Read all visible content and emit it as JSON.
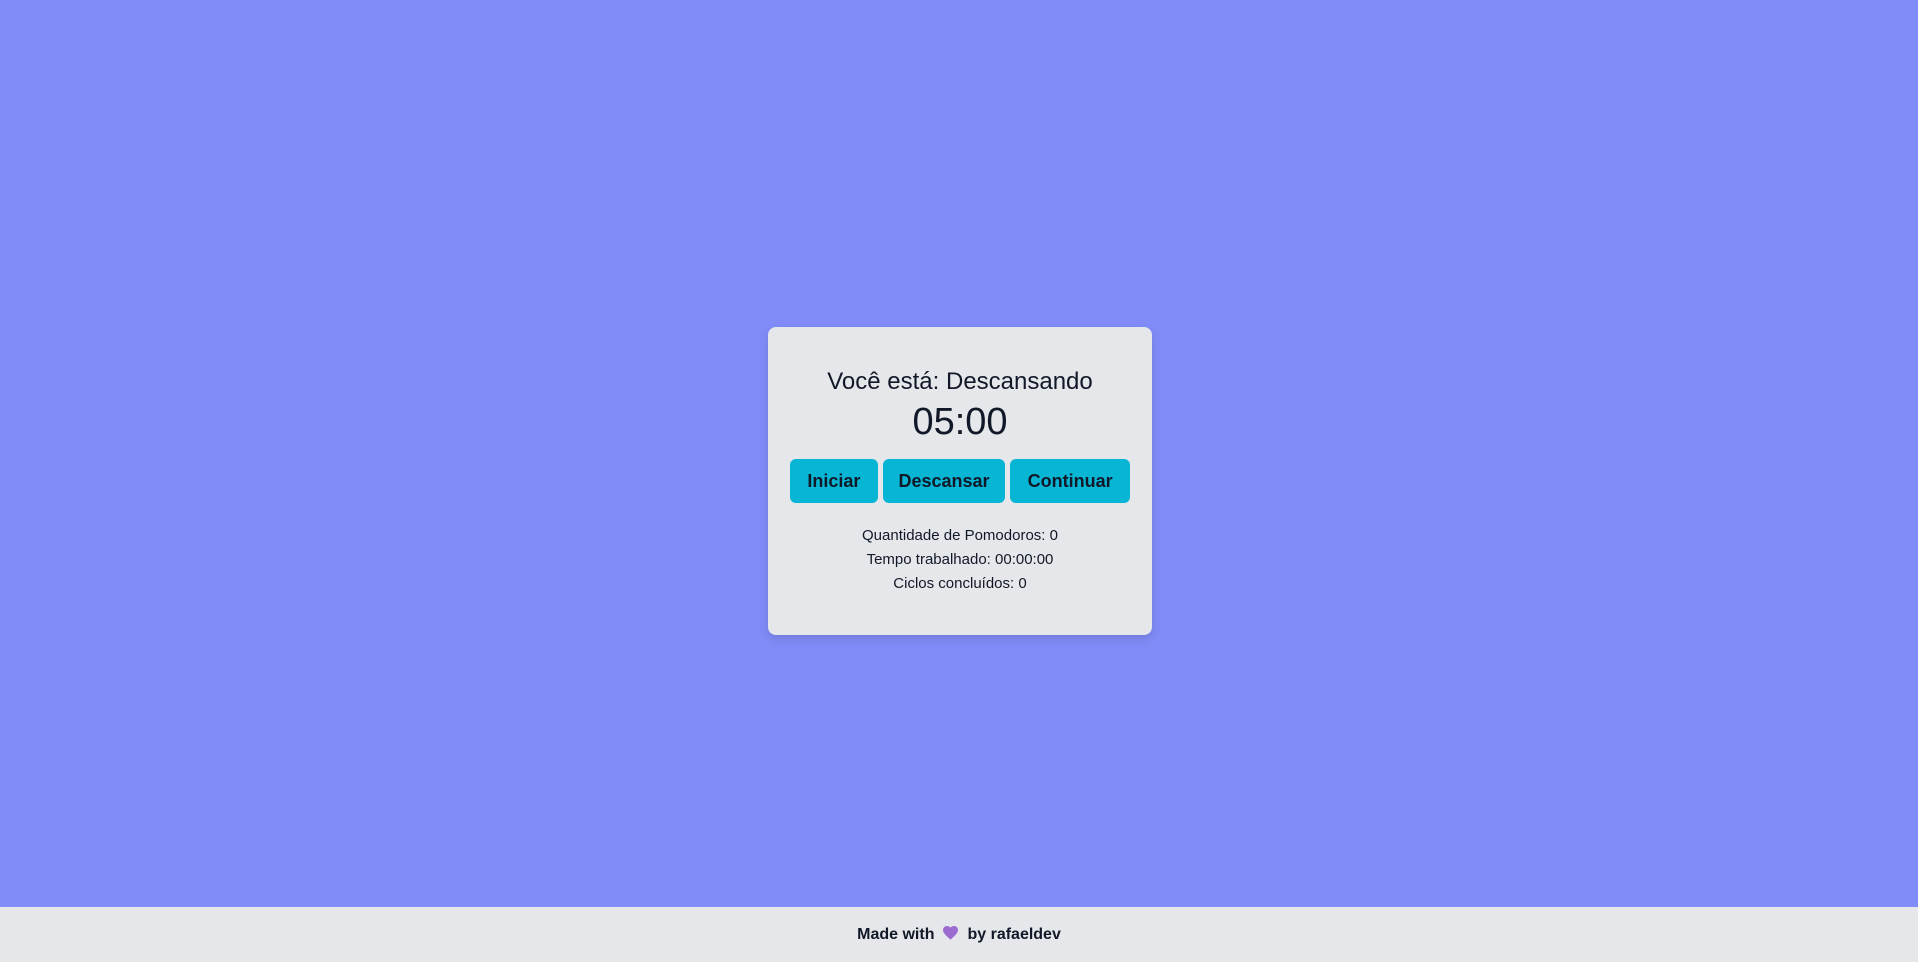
{
  "card": {
    "state_prefix": "Você está:",
    "state_value": "Descansando",
    "timer": "05:00"
  },
  "buttons": {
    "start": "Iniciar",
    "rest": "Descansar",
    "continue": "Continuar"
  },
  "stats": {
    "pomodoros_label": "Quantidade de Pomodoros:",
    "pomodoros_value": "0",
    "worked_label": "Tempo trabalhado:",
    "worked_value": "00:00:00",
    "cycles_label": "Ciclos concluídos:",
    "cycles_value": "0"
  },
  "footer": {
    "made_with": "Made with",
    "heart_icon": "heart-icon",
    "by": "by rafaeldev"
  },
  "colors": {
    "background": "#818cf8",
    "card": "#e5e7eb",
    "button": "#06b6d4",
    "heart": "#9b6bcf"
  }
}
